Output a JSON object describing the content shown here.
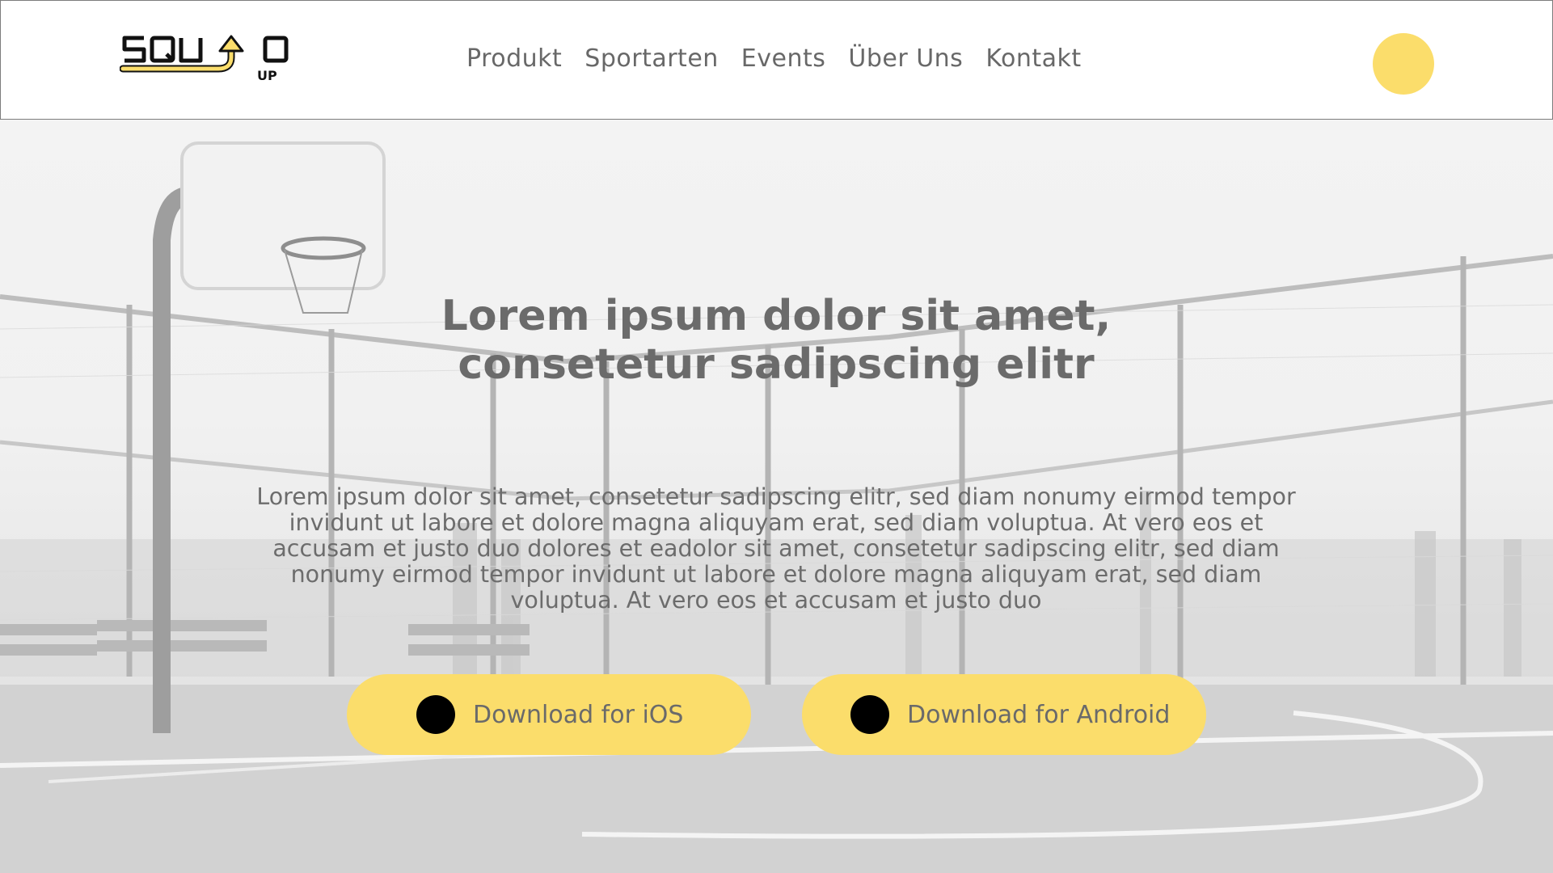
{
  "header": {
    "logo_text": "SQUAD UP",
    "nav": [
      "Produkt",
      "Sportarten",
      "Events",
      "Über Uns",
      "Kontakt"
    ]
  },
  "hero": {
    "title": "Lorem ipsum dolor sit amet, consetetur sadipscing elitr",
    "text": "Lorem ipsum dolor sit amet, consetetur sadipscing elitr, sed diam nonumy eirmod tempor invidunt ut labore et dolore magna aliquyam erat, sed diam voluptua. At vero eos et accusam et justo duo dolores et eadolor sit amet, consetetur sadipscing elitr, sed diam nonumy eirmod tempor invidunt ut labore et dolore magna aliquyam erat, sed diam voluptua. At vero eos et accusam et justo duo",
    "buttons": {
      "ios": "Download for iOS",
      "android": "Download for Android"
    }
  },
  "colors": {
    "accent": "#fbdd6b",
    "text": "#6b6b6b",
    "icon_dot": "#000000"
  },
  "icons": {
    "ios_button_icon": "circle-icon",
    "android_button_icon": "circle-icon",
    "avatar": "avatar-circle"
  }
}
